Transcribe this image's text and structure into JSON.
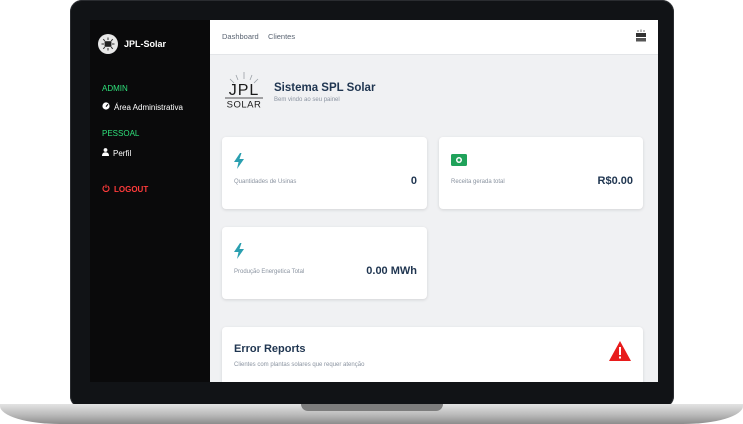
{
  "app": {
    "brand": "JPL-Solar"
  },
  "sidebar": {
    "sections": [
      {
        "heading": "ADMIN",
        "items": [
          {
            "label": "Área Administrativa",
            "icon": "gauge-icon"
          }
        ]
      },
      {
        "heading": "PESSOAL",
        "items": [
          {
            "label": "Perfil",
            "icon": "user-icon"
          }
        ]
      }
    ],
    "logout": {
      "label": "LOGOUT",
      "icon": "power-icon"
    }
  },
  "topbar": {
    "tabs": [
      "Dashboard",
      "Clientes"
    ],
    "logo_icon": "jpl-solar-logo"
  },
  "hero": {
    "logo_text_top": "JPL",
    "logo_text_bottom": "SOLAR",
    "title": "Sistema SPL Solar",
    "subtitle": "Bem vindo ao seu painel"
  },
  "cards": [
    {
      "label": "Quantidades de Usinas",
      "value": "0",
      "icon": "bolt-icon",
      "icon_color": "#2a9fb0"
    },
    {
      "label": "Receita gerada total",
      "value": "R$0.00",
      "icon": "money-icon",
      "icon_color": "#1fa25a"
    },
    {
      "label": "Produção Energetica Total",
      "value": "0.00 MWh",
      "icon": "bolt-icon",
      "icon_color": "#2a9fb0"
    }
  ],
  "error_reports": {
    "title": "Error Reports",
    "subtitle": "Clientes com plantas solares que requer atenção",
    "icon": "warning-icon",
    "icon_color": "#e81c1c"
  },
  "colors": {
    "sidebar_bg": "#0a0a0b",
    "section_heading": "#2ee07a",
    "logout": "#ff3b3b",
    "title_text": "#1f3550",
    "content_bg": "#f0f1f3"
  }
}
